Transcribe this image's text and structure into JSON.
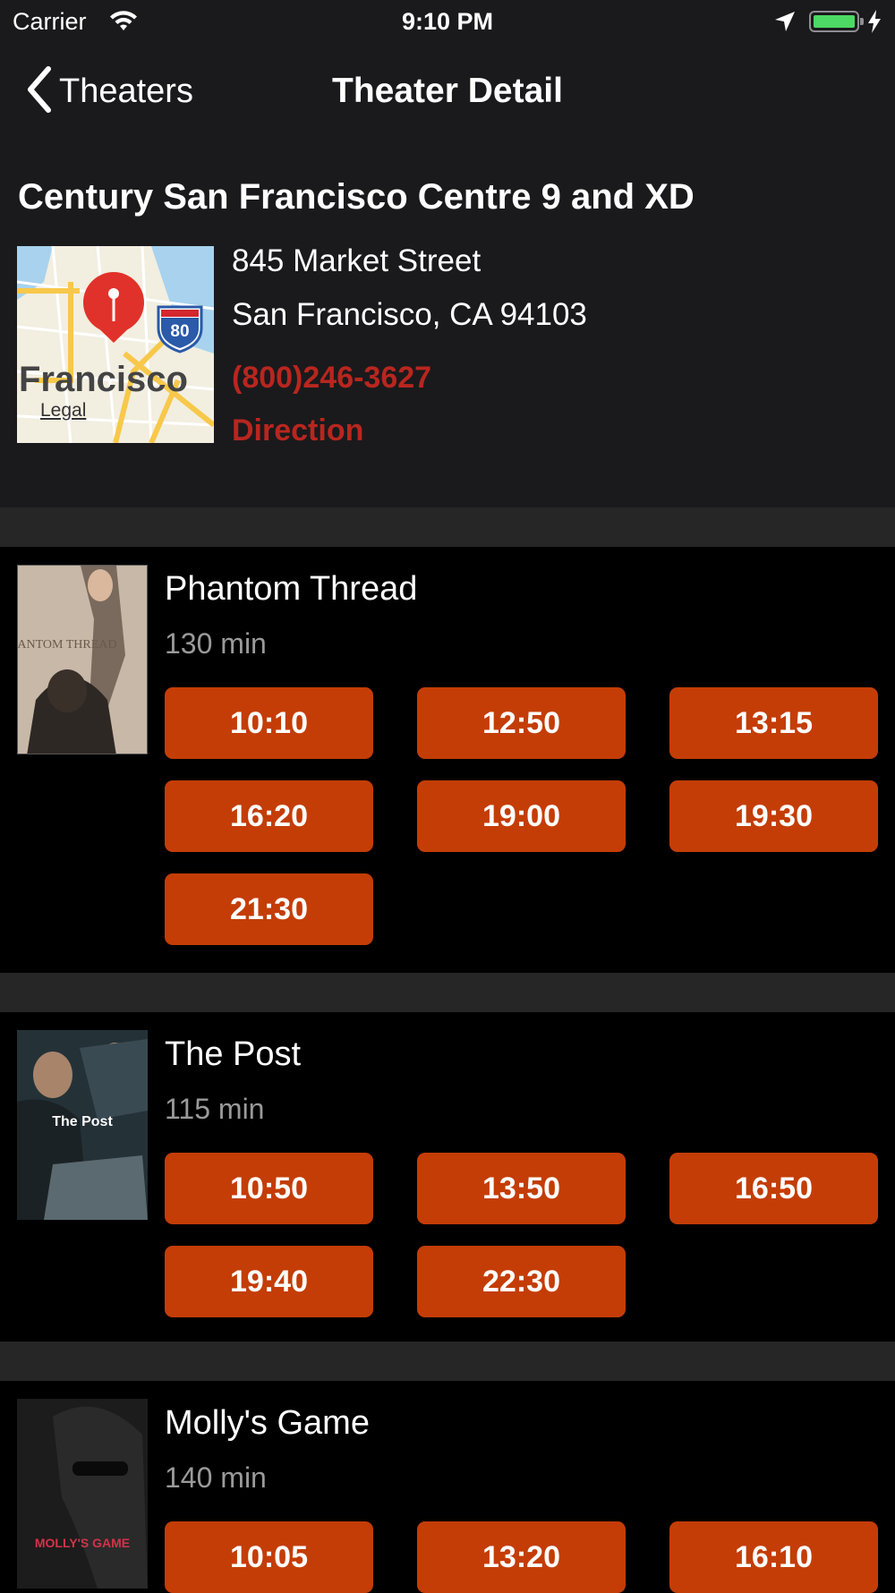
{
  "status_bar": {
    "carrier": "Carrier",
    "time": "9:10 PM",
    "battery_level": 1.0,
    "icons": [
      "wifi-icon",
      "location-arrow-icon",
      "battery-icon",
      "charging-bolt-icon"
    ]
  },
  "nav": {
    "back_label": "Theaters",
    "title": "Theater Detail"
  },
  "theater": {
    "name": "Century San Francisco Centre 9 and XD",
    "address_line1": "845 Market Street",
    "address_line2": "San Francisco, CA 94103",
    "phone": "(800)246-3627",
    "direction_label": "Direction",
    "map": {
      "place_label": "Francisco",
      "legal_label": "Legal",
      "highway_shield": "80"
    }
  },
  "colors": {
    "accent_red": "#b8261f",
    "showtime_button": "#c43d06",
    "background": "#000000",
    "header_background": "#1a1a1c",
    "secondary_text": "#9a9a9a"
  },
  "movies": [
    {
      "title": "Phantom Thread",
      "duration": "130 min",
      "poster_text": "PHANTOM THREAD",
      "showtimes": [
        "10:10",
        "12:50",
        "13:15",
        "16:20",
        "19:00",
        "19:30",
        "21:30"
      ]
    },
    {
      "title": "The Post",
      "duration": "115 min",
      "poster_text": "The Post",
      "showtimes": [
        "10:50",
        "13:50",
        "16:50",
        "19:40",
        "22:30"
      ]
    },
    {
      "title": "Molly's Game",
      "duration": "140 min",
      "poster_text": "MOLLY'S GAME",
      "showtimes": [
        "10:05",
        "13:20",
        "16:10"
      ]
    }
  ]
}
